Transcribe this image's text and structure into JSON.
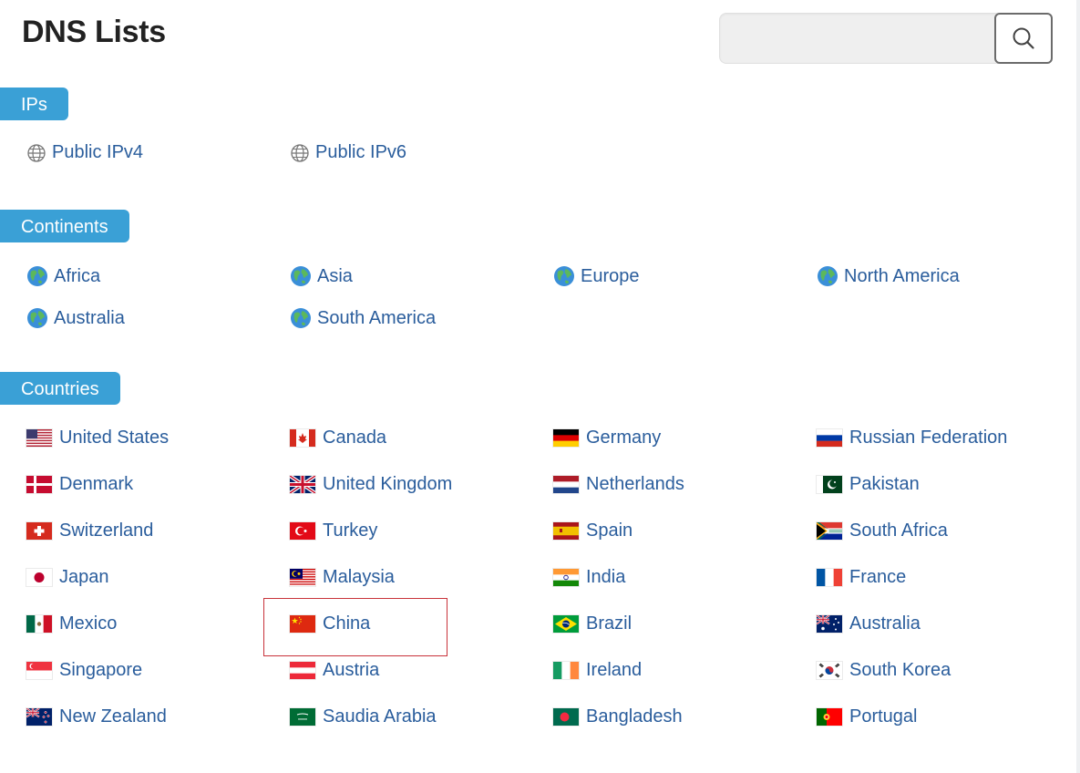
{
  "page": {
    "title": "DNS Lists"
  },
  "search": {
    "placeholder": "",
    "value": "",
    "icon": "search-icon"
  },
  "sections": {
    "ips": {
      "label": "IPs",
      "items": [
        {
          "label": "Public IPv4",
          "icon": "network-globe-icon"
        },
        {
          "label": "Public IPv6",
          "icon": "network-globe-icon"
        }
      ]
    },
    "continents": {
      "label": "Continents",
      "items": [
        {
          "label": "Africa",
          "icon": "earth-globe-icon"
        },
        {
          "label": "Asia",
          "icon": "earth-globe-icon"
        },
        {
          "label": "Europe",
          "icon": "earth-globe-icon"
        },
        {
          "label": "North America",
          "icon": "earth-globe-icon"
        },
        {
          "label": "Australia",
          "icon": "earth-globe-icon"
        },
        {
          "label": "South America",
          "icon": "earth-globe-icon"
        }
      ]
    },
    "countries": {
      "label": "Countries",
      "items": [
        {
          "label": "United States",
          "flag": "us"
        },
        {
          "label": "Canada",
          "flag": "ca"
        },
        {
          "label": "Germany",
          "flag": "de"
        },
        {
          "label": "Russian Federation",
          "flag": "ru"
        },
        {
          "label": "Denmark",
          "flag": "dk"
        },
        {
          "label": "United Kingdom",
          "flag": "gb"
        },
        {
          "label": "Netherlands",
          "flag": "nl"
        },
        {
          "label": "Pakistan",
          "flag": "pk"
        },
        {
          "label": "Switzerland",
          "flag": "ch"
        },
        {
          "label": "Turkey",
          "flag": "tr"
        },
        {
          "label": "Spain",
          "flag": "es"
        },
        {
          "label": "South Africa",
          "flag": "za"
        },
        {
          "label": "Japan",
          "flag": "jp"
        },
        {
          "label": "Malaysia",
          "flag": "my"
        },
        {
          "label": "India",
          "flag": "in"
        },
        {
          "label": "France",
          "flag": "fr"
        },
        {
          "label": "Mexico",
          "flag": "mx"
        },
        {
          "label": "China",
          "flag": "cn",
          "highlighted": true
        },
        {
          "label": "Brazil",
          "flag": "br"
        },
        {
          "label": "Australia",
          "flag": "au"
        },
        {
          "label": "Singapore",
          "flag": "sg"
        },
        {
          "label": "Austria",
          "flag": "at"
        },
        {
          "label": "Ireland",
          "flag": "ie"
        },
        {
          "label": "South Korea",
          "flag": "kr"
        },
        {
          "label": "New Zealand",
          "flag": "nz"
        },
        {
          "label": "Saudia Arabia",
          "flag": "sa"
        },
        {
          "label": "Bangladesh",
          "flag": "bd"
        },
        {
          "label": "Portugal",
          "flag": "pt"
        }
      ]
    }
  },
  "colors": {
    "accent": "#3aa0d6",
    "link": "#2a5d9c",
    "highlight": "#c8323a"
  }
}
